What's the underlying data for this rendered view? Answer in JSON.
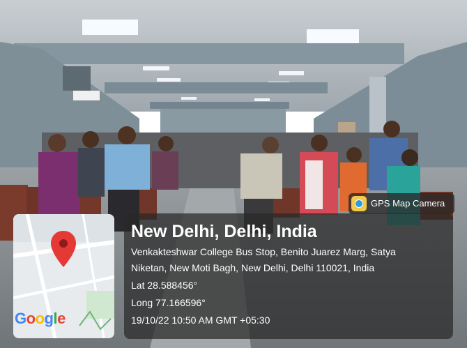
{
  "overlay": {
    "app_label": "GPS Map Camera",
    "location_title": "New Delhi, Delhi, India",
    "address_line1": "Venkakteshwar College Bus Stop, Benito Juarez Marg, Satya",
    "address_line2": "Niketan, New Moti Bagh, New Delhi, Delhi 110021, India",
    "latitude": "Lat 28.588456°",
    "longitude": "Long 77.166596°",
    "timestamp": "19/10/22 10:50 AM GMT +05:30"
  },
  "map": {
    "logo": "Google",
    "pin_color": "#e53935"
  },
  "icons": {
    "camera": "gps-map-camera-icon",
    "pin": "map-pin-icon"
  }
}
